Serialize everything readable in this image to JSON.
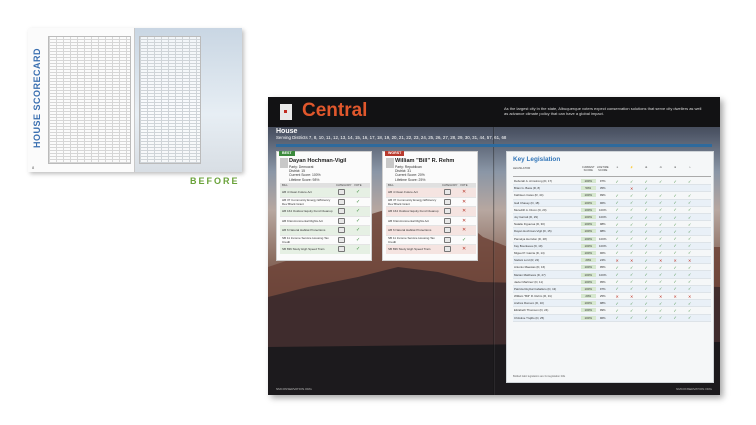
{
  "before": {
    "title": "HOUSE SCORECARD",
    "label": "BEFORE",
    "page_number": "8"
  },
  "after": {
    "region": "Central",
    "intro": "As the largest city in the state, Albuquerque voters expect conservation solutions that serve city dwellers as well as advance climate policy that can have a global impact.",
    "chamber": "House",
    "districts": "Serving Districts 7, 8, 10, 11, 12, 13, 14, 15, 16, 17, 18, 19, 20, 21, 22, 23, 24, 25, 26, 27, 28, 29, 30, 31, 44, 57, 61, 68",
    "best": {
      "tag": "BEST",
      "name": "Dayan Hochman-Vigil",
      "party": "Party: Democrat",
      "district": "District: 15",
      "current": "Current Score: 100%",
      "lifetime": "Lifetime Score: 98%",
      "col_bill": "BILL",
      "col_category": "CATEGORY",
      "col_vote": "VOTE",
      "bills": [
        "HB 4 Clean Future Act",
        "HB 37 Community Energy Efficiency Dev Block Grant",
        "HB 164 Outdoor Equity Fund Cleanup",
        "HB 9 Environmental Rights Act",
        "HB 6 Natural Habitat Protections",
        "SB 11 Income Service Housing Tax Credit",
        "SB 836 Study High Speed Train"
      ]
    },
    "worst": {
      "tag": "WORST",
      "name": "William \"Bill\" R. Rehm",
      "party": "Party: Republican",
      "district": "District: 31",
      "current": "Current Score: 20%",
      "lifetime": "Lifetime Score: 25%",
      "col_bill": "BILL",
      "col_category": "CATEGORY",
      "col_vote": "VOTE",
      "bills": [
        "HB 4 Clean Future Act",
        "HB 37 Community Energy Efficiency Dev Block Grant",
        "HB 164 Outdoor Equity Fund Cleanup",
        "HB 9 Environmental Rights Act",
        "HB 6 Natural Habitat Protections",
        "SB 11 Income Service Housing Tax Credit",
        "SB 836 Study High Speed Train"
      ],
      "votes": [
        "✕",
        "✕",
        "✕",
        "✕",
        "✕",
        "✓",
        "✕"
      ]
    },
    "key_legislation": {
      "title": "Key Legislation",
      "legislator_header": "LEGISLATOR",
      "col_current": "CURRENT SCORE",
      "col_lifetime": "LIFETIME SCORE",
      "rows": [
        {
          "name": "Deborah A. Armstrong (D, 17)",
          "cur": "100%",
          "life": "97%",
          "marks": [
            "✓",
            "✓",
            "✓",
            "✓",
            "✓",
            "✓"
          ]
        },
        {
          "name": "Brian G. Baca (R, 8)",
          "cur": "50%",
          "life": "35%",
          "marks": [
            "",
            "✕",
            "✓",
            "",
            "",
            ""
          ]
        },
        {
          "name": "Kathleen Cates (R, 44)",
          "cur": "100%",
          "life": "99%",
          "marks": [
            "✓",
            "✓",
            "✓",
            "✓",
            "✓",
            "✓"
          ]
        },
        {
          "name": "Gail Chasey (D, 18)",
          "cur": "100%",
          "life": "96%",
          "marks": [
            "✓",
            "✓",
            "✓",
            "✓",
            "✓",
            "✓"
          ]
        },
        {
          "name": "Meredith A. Dixon (D, 20)",
          "cur": "100%",
          "life": "100%",
          "marks": [
            "✓",
            "✓",
            "✓",
            "✓",
            "✓",
            "✓"
          ]
        },
        {
          "name": "Joy Garratt (D, 29)",
          "cur": "100%",
          "life": "100%",
          "marks": [
            "✓",
            "✓",
            "✓",
            "✓",
            "✓",
            "✓"
          ]
        },
        {
          "name": "Natalie Figueroa (D, 30)",
          "cur": "100%",
          "life": "98%",
          "marks": [
            "✓",
            "✓",
            "✓",
            "✓",
            "✓",
            "✓"
          ]
        },
        {
          "name": "Dayan Hochman-Vigil (D, 15)",
          "cur": "100%",
          "life": "98%",
          "marks": [
            "✓",
            "✓",
            "✓",
            "✓",
            "✓",
            "✓"
          ]
        },
        {
          "name": "Pamelya Herndon (D, 28)",
          "cur": "100%",
          "life": "100%",
          "marks": [
            "✓",
            "✓",
            "✓",
            "✓",
            "✓",
            "✓"
          ]
        },
        {
          "name": "Kay Bounkeua (D, 19)",
          "cur": "100%",
          "life": "100%",
          "marks": [
            "✓",
            "✓",
            "✓",
            "✓",
            "✓",
            "✓"
          ]
        },
        {
          "name": "Miguel P. Garcia (D, 14)",
          "cur": "100%",
          "life": "96%",
          "marks": [
            "✓",
            "✓",
            "✓",
            "✓",
            "✓",
            "✓"
          ]
        },
        {
          "name": "Stefani Lord (R, 22)",
          "cur": "20%",
          "life": "24%",
          "marks": [
            "✕",
            "✕",
            "✓",
            "✕",
            "✕",
            "✕"
          ]
        },
        {
          "name": "Antonio Maestas (D, 16)",
          "cur": "100%",
          "life": "95%",
          "marks": [
            "✓",
            "✓",
            "✓",
            "✓",
            "✓",
            "✓"
          ]
        },
        {
          "name": "Marian Matthews (D, 27)",
          "cur": "100%",
          "life": "100%",
          "marks": [
            "✓",
            "✓",
            "✓",
            "✓",
            "✓",
            "✓"
          ]
        },
        {
          "name": "Javier Martinez (D, 11)",
          "cur": "100%",
          "life": "95%",
          "marks": [
            "✓",
            "✓",
            "✓",
            "✓",
            "✓",
            "✓"
          ]
        },
        {
          "name": "Patricia Roybal Caballero (D, 13)",
          "cur": "100%",
          "life": "97%",
          "marks": [
            "✓",
            "✓",
            "✓",
            "✓",
            "✓",
            "✓"
          ]
        },
        {
          "name": "William \"Bill\" R. Rehm (R, 31)",
          "cur": "20%",
          "life": "25%",
          "marks": [
            "✕",
            "✕",
            "✓",
            "✕",
            "✕",
            "✕"
          ]
        },
        {
          "name": "Andrés Romero (D, 10)",
          "cur": "100%",
          "life": "98%",
          "marks": [
            "✓",
            "✓",
            "✓",
            "✓",
            "✓",
            "✓"
          ]
        },
        {
          "name": "Elizabeth Thomson (D, 24)",
          "cur": "100%",
          "life": "99%",
          "marks": [
            "✓",
            "✓",
            "✓",
            "✓",
            "✓",
            "✓"
          ]
        },
        {
          "name": "Christine Trujillo (D, 25)",
          "cur": "100%",
          "life": "96%",
          "marks": [
            "✓",
            "✓",
            "✓",
            "✓",
            "✓",
            "✓"
          ]
        }
      ],
      "footnote": "Bolded italic legislators are for-legislation bills"
    },
    "folio_left": "NMCONSERVATION.ORG",
    "folio_right": "NMCONSERVATION.ORG"
  }
}
